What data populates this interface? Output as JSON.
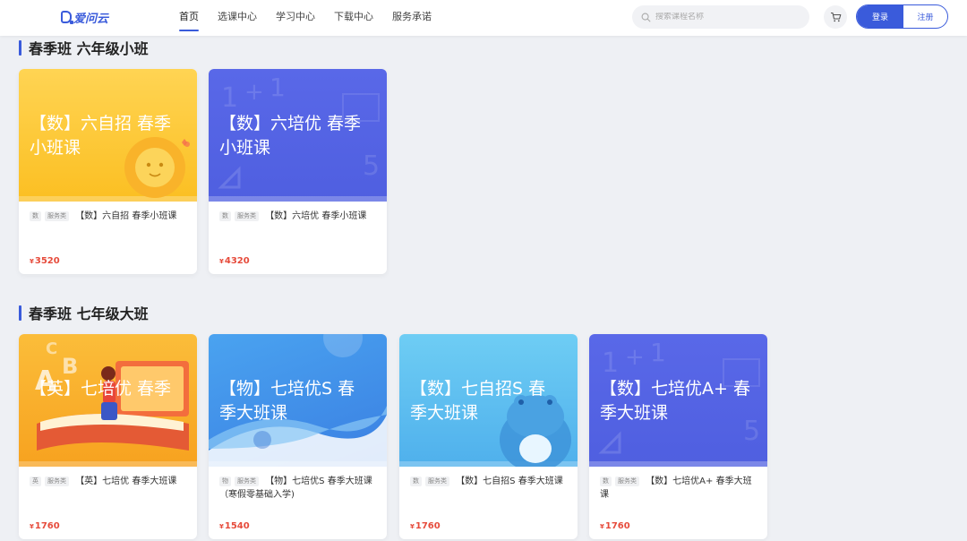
{
  "header": {
    "logo_text": "爱问云",
    "nav": [
      "首页",
      "选课中心",
      "学习中心",
      "下载中心",
      "服务承诺"
    ],
    "search_placeholder": "搜索课程名称",
    "login_label": "登录",
    "register_label": "注册"
  },
  "sections": [
    {
      "title": "春季班 六年级小班",
      "cards": [
        {
          "cover_title": "【数】六自招 春季小班课",
          "subject_tag": "数",
          "service_tag": "服务类",
          "name": "【数】六自招 春季小班课",
          "currency": "¥",
          "price": "3520",
          "theme": "yellow"
        },
        {
          "cover_title": "【数】六培优 春季小班课",
          "subject_tag": "数",
          "service_tag": "服务类",
          "name": "【数】六培优 春季小班课",
          "currency": "¥",
          "price": "4320",
          "theme": "indigo"
        }
      ]
    },
    {
      "title": "春季班 七年级大班",
      "cards": [
        {
          "cover_title": "【英】七培优 春季",
          "subject_tag": "英",
          "service_tag": "服务类",
          "name": "【英】七培优 春季大班课",
          "currency": "¥",
          "price": "1760",
          "theme": "orange"
        },
        {
          "cover_title": "【物】七培优S 春季大班课",
          "subject_tag": "物",
          "service_tag": "服务类",
          "name": "【物】七培优S 春季大班课（寒假零基础入学)",
          "currency": "¥",
          "price": "1540",
          "theme": "blue"
        },
        {
          "cover_title": "【数】七自招S 春季大班课",
          "subject_tag": "数",
          "service_tag": "服务类",
          "name": "【数】七自招S 春季大班课",
          "currency": "¥",
          "price": "1760",
          "theme": "sky"
        },
        {
          "cover_title": "【数】七培优A+ 春季大班课",
          "subject_tag": "数",
          "service_tag": "服务类",
          "name": "【数】七培优A+ 春季大班课",
          "currency": "¥",
          "price": "1760",
          "theme": "indigo"
        }
      ]
    }
  ],
  "colors": {
    "accent": "#3a5bdb",
    "price": "#e64b3b",
    "yellow": "#fcc12d",
    "indigo": "#5b6be6",
    "orange": "#f9b52c",
    "blue": "#3d8fe8",
    "sky": "#5cb7ee"
  }
}
